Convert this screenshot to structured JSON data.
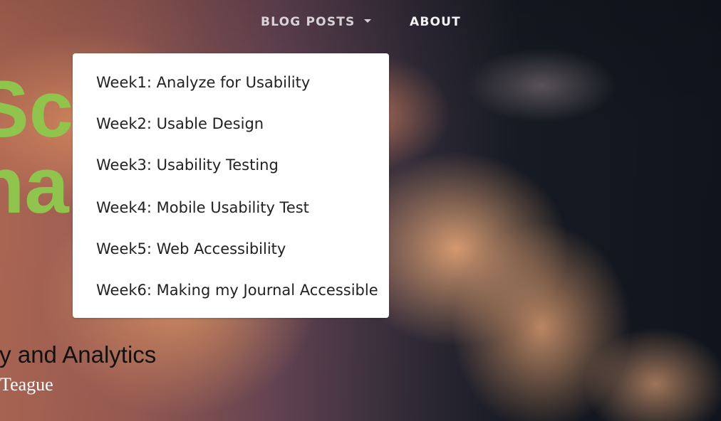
{
  "nav": {
    "blog_posts_label": "BLOG POSTS",
    "about_label": "ABOUT"
  },
  "dropdown": {
    "items": [
      "Week1: Analyze for Usability",
      "Week2: Usable Design",
      "Week3: Usability Testing",
      "Week4: Mobile Usability Test",
      "Week5: Web Accessibility",
      "Week6: Making my Journal Accessible"
    ]
  },
  "hero": {
    "title_line_1": "Sci",
    "title_line_2": "na",
    "subtitle": "ty and Analytics",
    "author": "Teague"
  },
  "colors": {
    "title_green": "#8fc44d",
    "menu_background": "#ffffff",
    "menu_text": "#222222"
  }
}
